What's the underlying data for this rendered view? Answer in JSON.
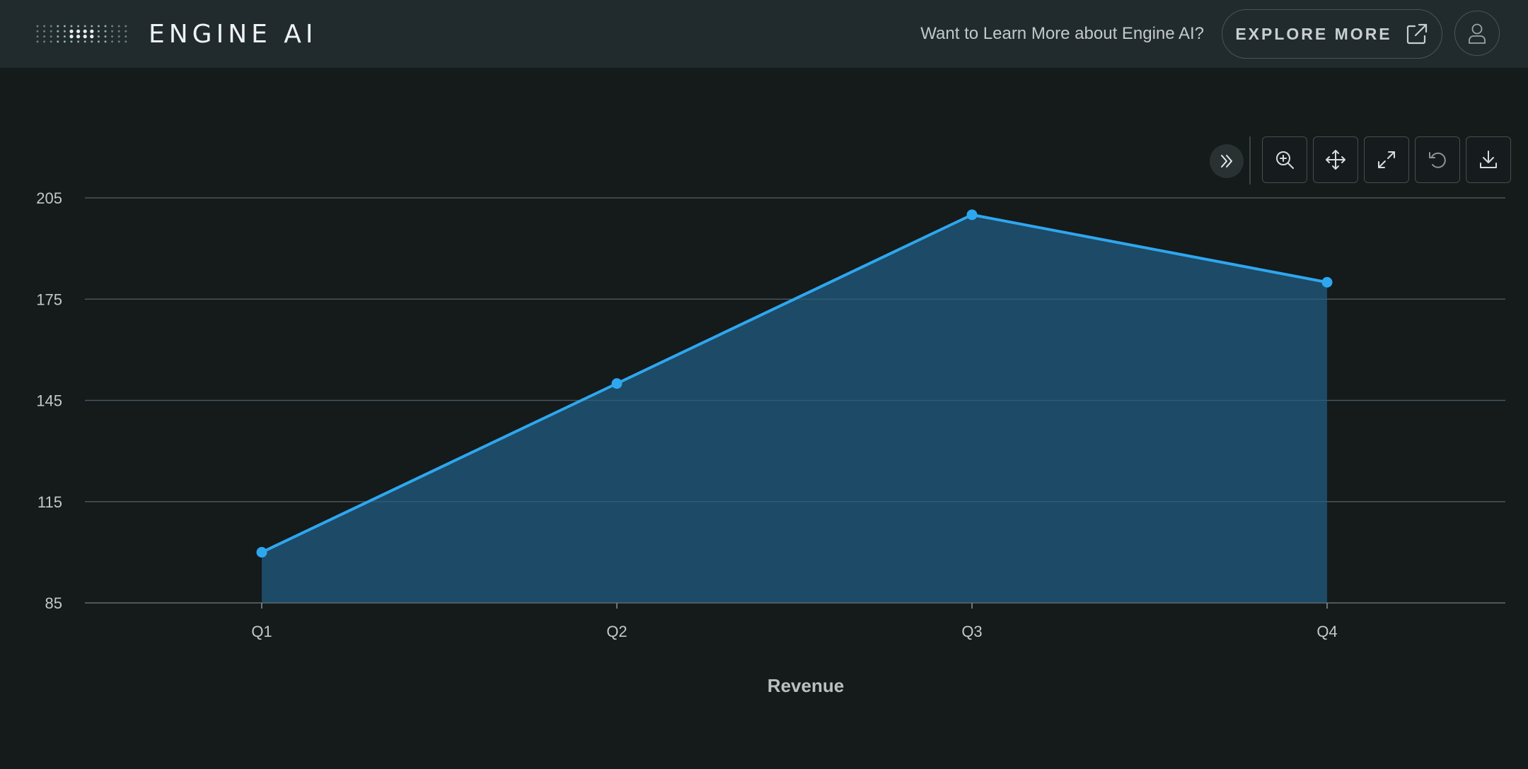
{
  "header": {
    "brand": "ENGINE AI",
    "promo_text": "Want to Learn More about Engine AI?",
    "explore_label": "EXPLORE MORE",
    "explore_icon": "external-link-icon",
    "avatar_icon": "user-icon"
  },
  "toolbar": {
    "buttons": [
      {
        "name": "collapse-toolbar-button",
        "icon": "double-chevron-right-icon"
      },
      {
        "name": "zoom-button",
        "icon": "zoom-in-icon"
      },
      {
        "name": "pan-button",
        "icon": "move-icon"
      },
      {
        "name": "fit-button",
        "icon": "expand-icon"
      },
      {
        "name": "reset-button",
        "icon": "reset-icon"
      },
      {
        "name": "download-button",
        "icon": "download-icon"
      }
    ]
  },
  "colors": {
    "header_bg": "#212a2c",
    "page_bg": "#151a1b",
    "line": "#2ea7ef",
    "area_fill": "#1d4d6a",
    "grid": "#3d4547"
  },
  "chart_data": {
    "type": "area",
    "categories": [
      "Q1",
      "Q2",
      "Q3",
      "Q4"
    ],
    "series": [
      {
        "values": [
          100,
          150,
          200,
          180
        ]
      }
    ],
    "xlabel": "Revenue",
    "ylabel": "",
    "ylim": [
      85,
      205
    ],
    "yticks": [
      85,
      115,
      145,
      175,
      205
    ],
    "grid": true,
    "markers": true
  }
}
